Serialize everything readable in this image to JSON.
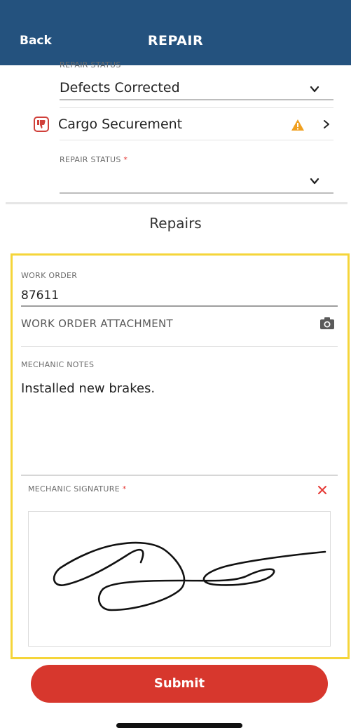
{
  "header": {
    "back_label": "Back",
    "title": "REPAIR"
  },
  "defect_prev": {
    "repair_status_label": "REPAIR STATUS",
    "repair_status_value": "Defects Corrected"
  },
  "defect_item": {
    "label": "Cargo Securement",
    "repair_status_label": "REPAIR STATUS",
    "required_marker": "*",
    "repair_status_value": ""
  },
  "repairs": {
    "section_title": "Repairs",
    "work_order_label": "WORK ORDER",
    "work_order_value": "87611",
    "work_order_attachment_label": "WORK ORDER ATTACHMENT",
    "mechanic_notes_label": "MECHANIC NOTES",
    "mechanic_notes_value": "Installed new brakes.",
    "mechanic_signature_label": "MECHANIC SIGNATURE",
    "required_marker": "*"
  },
  "submit_label": "Submit",
  "icons": {
    "back": "back-text",
    "chevron": "chevron-down-icon",
    "thumbs_down": "thumbs-down-icon",
    "warning": "warning-icon",
    "camera": "camera-icon",
    "close": "close-icon"
  },
  "colors": {
    "header_bg": "#24527e",
    "highlight_border": "#f5d53a",
    "submit_bg": "#d7372d",
    "required": "#e53935",
    "warning": "#f0a020"
  }
}
